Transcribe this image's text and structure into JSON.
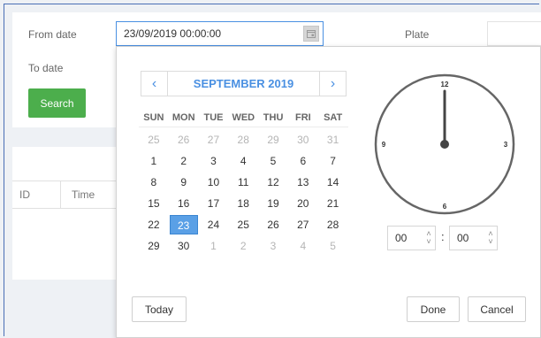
{
  "form": {
    "from_label": "From date",
    "from_value": "23/09/2019 00:00:00",
    "to_label": "To date",
    "plate_label": "Plate",
    "search_label": "Search"
  },
  "table": {
    "columns": [
      "ID",
      "Time"
    ]
  },
  "calendar": {
    "month_label": "SEPTEMBER 2019",
    "prev_icon": "‹",
    "next_icon": "›",
    "weekdays": [
      "SUN",
      "MON",
      "TUE",
      "WED",
      "THU",
      "FRI",
      "SAT"
    ],
    "weeks": [
      [
        {
          "d": "25",
          "m": true
        },
        {
          "d": "26",
          "m": true
        },
        {
          "d": "27",
          "m": true
        },
        {
          "d": "28",
          "m": true
        },
        {
          "d": "29",
          "m": true
        },
        {
          "d": "30",
          "m": true
        },
        {
          "d": "31",
          "m": true
        }
      ],
      [
        {
          "d": "1"
        },
        {
          "d": "2"
        },
        {
          "d": "3"
        },
        {
          "d": "4"
        },
        {
          "d": "5"
        },
        {
          "d": "6"
        },
        {
          "d": "7"
        }
      ],
      [
        {
          "d": "8"
        },
        {
          "d": "9"
        },
        {
          "d": "10"
        },
        {
          "d": "11"
        },
        {
          "d": "12"
        },
        {
          "d": "13"
        },
        {
          "d": "14"
        }
      ],
      [
        {
          "d": "15"
        },
        {
          "d": "16"
        },
        {
          "d": "17"
        },
        {
          "d": "18"
        },
        {
          "d": "19"
        },
        {
          "d": "20"
        },
        {
          "d": "21"
        }
      ],
      [
        {
          "d": "22"
        },
        {
          "d": "23",
          "s": true
        },
        {
          "d": "24"
        },
        {
          "d": "25"
        },
        {
          "d": "26"
        },
        {
          "d": "27"
        },
        {
          "d": "28"
        }
      ],
      [
        {
          "d": "29"
        },
        {
          "d": "30"
        },
        {
          "d": "1",
          "m": true
        },
        {
          "d": "2",
          "m": true
        },
        {
          "d": "3",
          "m": true
        },
        {
          "d": "4",
          "m": true
        },
        {
          "d": "5",
          "m": true
        }
      ]
    ],
    "selected_color": "#5aa0e6",
    "accent_color": "#4a90e2"
  },
  "clock": {
    "n12": "12",
    "n3": "3",
    "n6": "6",
    "n9": "9",
    "hour_value": "00",
    "minute_value": "00",
    "separator": ":"
  },
  "buttons": {
    "today": "Today",
    "done": "Done",
    "cancel": "Cancel"
  },
  "colors": {
    "search_button": "#4cae4c",
    "input_border": "#4a90e2"
  }
}
